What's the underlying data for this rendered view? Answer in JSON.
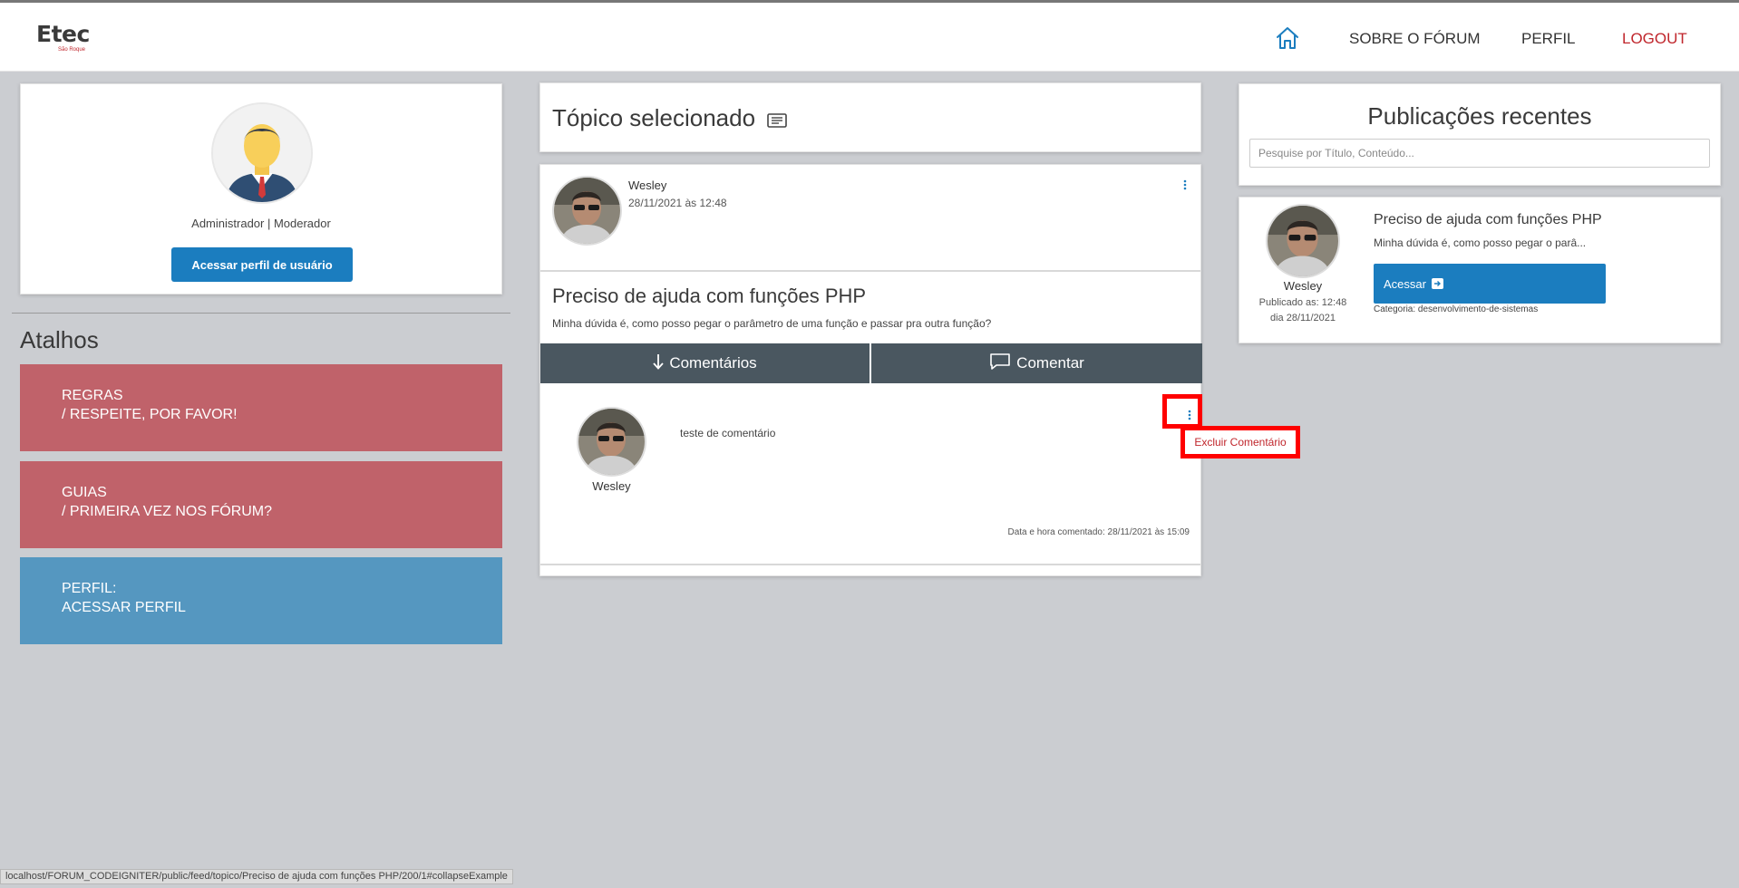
{
  "header": {
    "logo_main": "Etec",
    "logo_sub": "São Roque",
    "home_icon": "home-icon",
    "nav": {
      "sobre": "SOBRE O FÓRUM",
      "perfil": "PERFIL",
      "logout": "LOGOUT"
    }
  },
  "profile": {
    "avatar_icon": "user-avatar-icon",
    "role": "Administrador | Moderador",
    "button_label": "Acessar perfil de usuário"
  },
  "shortcuts": {
    "title": "Atalhos",
    "items": [
      {
        "line1": "REGRAS",
        "line2": "/ RESPEITE, POR FAVOR!",
        "color": "#c0626a"
      },
      {
        "line1": "GUIAS",
        "line2": "/ PRIMEIRA VEZ NOS FÓRUM?",
        "color": "#c0626a"
      },
      {
        "line1": "PERFIL:",
        "line2": "ACESSAR PERFIL",
        "color": "#5597c0"
      }
    ]
  },
  "topic": {
    "header_title": "Tópico selecionado",
    "header_icon": "document-icon",
    "post": {
      "author": "Wesley",
      "date": "28/11/2021 às 12:48",
      "title": "Preciso de ajuda com funções PHP",
      "content": "Minha dúvida é, como posso pegar o parâmetro de uma função e passar pra outra função?",
      "tabs": {
        "comments_label": "Comentários",
        "comment_label": "Comentar"
      }
    },
    "comment": {
      "author": "Wesley",
      "text": "teste de comentário",
      "menu_item": "Excluir Comentário",
      "datetime": "Data e hora comentado: 28/11/2021 às 15:09"
    }
  },
  "recent": {
    "title": "Publicações recentes",
    "search_placeholder": "Pesquise por Título, Conteúdo...",
    "items": [
      {
        "author": "Wesley",
        "published_line1": "Publicado as: 12:48",
        "published_line2": "dia 28/11/2021",
        "title": "Preciso de ajuda com funções PHP",
        "excerpt": "Minha dúvida é, como posso pegar o parâ...",
        "button_label": "Acessar",
        "category": "Categoria: desenvolvimento-de-sistemas"
      }
    ]
  },
  "status_bar": {
    "url": "localhost/FORUM_CODEIGNITER/public/feed/topico/Preciso de ajuda com funções PHP/200/1#collapseExample"
  },
  "colors": {
    "accent_blue": "#1b7dbf",
    "logout_red": "#c0262c",
    "tab_dark": "#4a5760",
    "highlight_red": "#ff0000"
  }
}
